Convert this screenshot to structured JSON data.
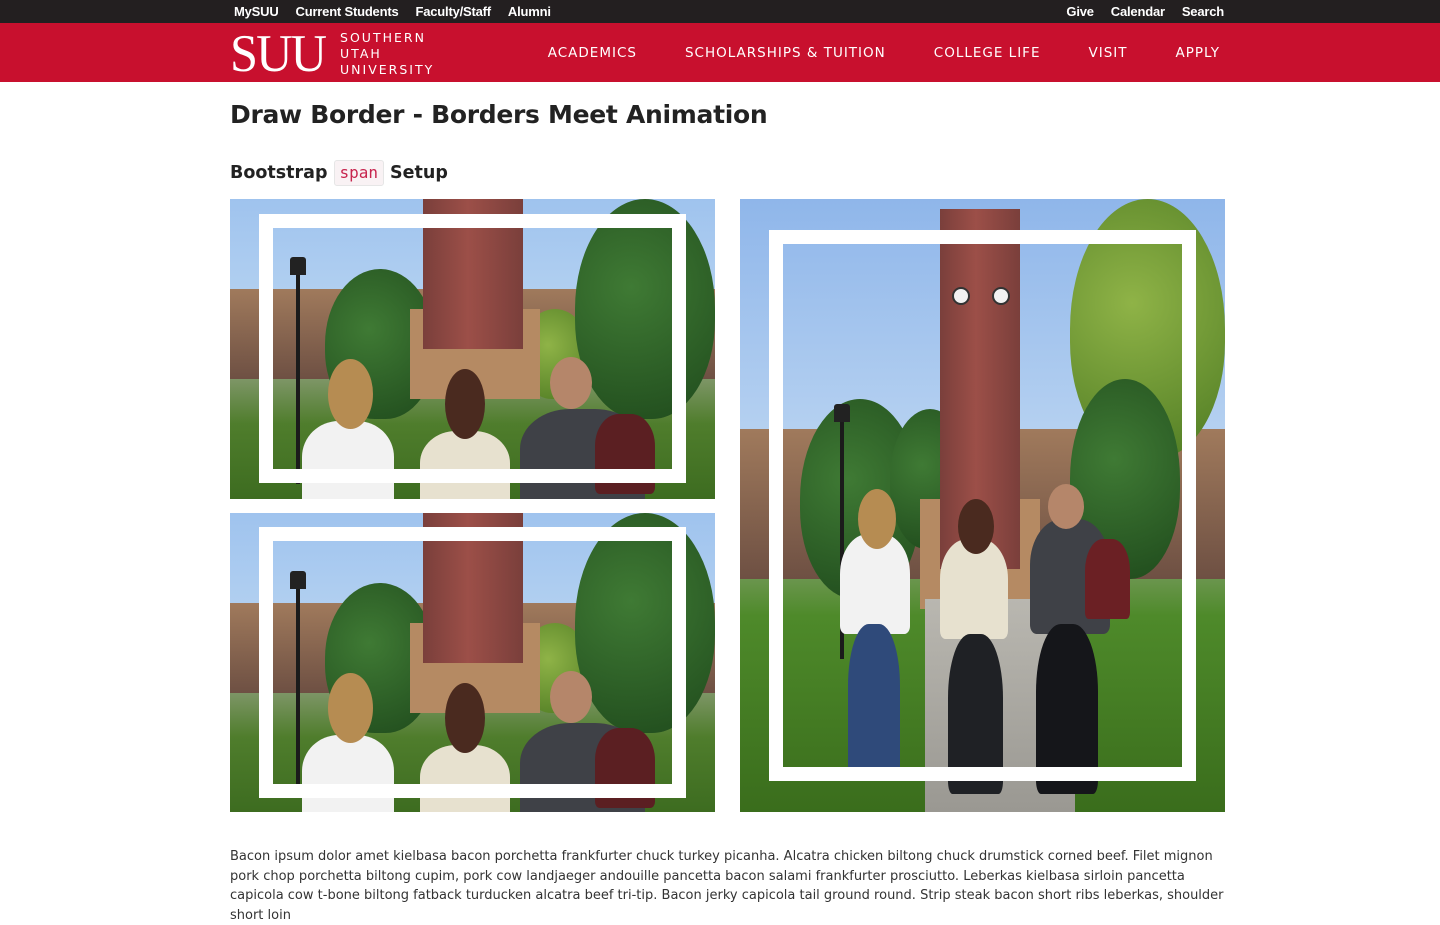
{
  "utility_nav": {
    "left": [
      "MySUU",
      "Current Students",
      "Faculty/Staff",
      "Alumni"
    ],
    "right": [
      "Give",
      "Calendar",
      "Search"
    ]
  },
  "brand": {
    "mark": "SUU",
    "line1": "SOUTHERN",
    "line2": "UTAH",
    "line3": "UNIVERSITY"
  },
  "main_nav": [
    "ACADEMICS",
    "SCHOLARSHIPS & TUITION",
    "COLLEGE LIFE",
    "VISIT",
    "APPLY"
  ],
  "page": {
    "title": "Draw Border - Borders Meet Animation",
    "subtitle_before": "Bootstrap",
    "subtitle_code": "span",
    "subtitle_after": "Setup",
    "body": "Bacon ipsum dolor amet kielbasa bacon porchetta frankfurter chuck turkey picanha. Alcatra chicken biltong chuck drumstick corned beef. Filet mignon pork chop porchetta biltong cupim, pork cow landjaeger andouille pancetta bacon salami frankfurter prosciutto. Leberkas kielbasa sirloin pancetta capicola cow t-bone biltong fatback turducken alcatra beef tri-tip. Bacon jerky capicola tail ground round. Strip steak bacon short ribs leberkas, shoulder short loin"
  },
  "colors": {
    "utility_bg": "#231f20",
    "brand_red": "#c8102e",
    "code_text": "#c7254e"
  }
}
